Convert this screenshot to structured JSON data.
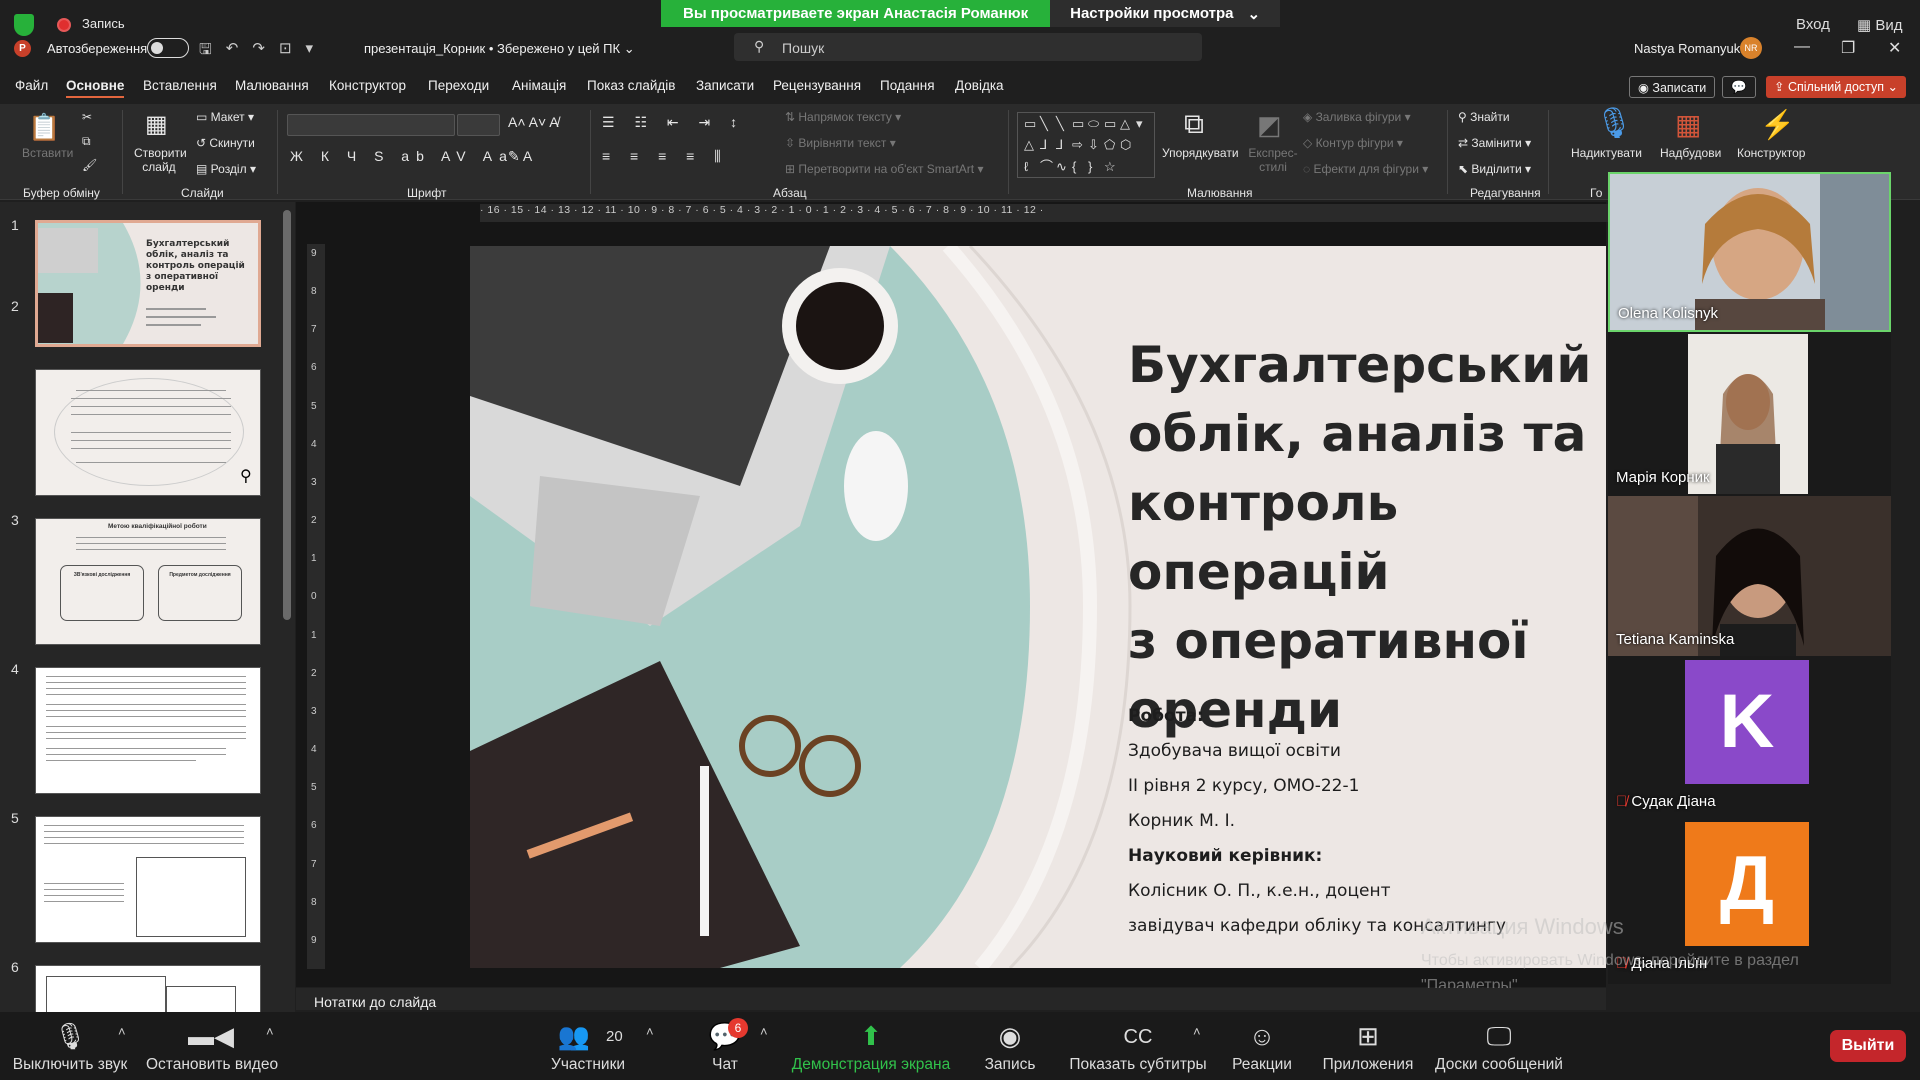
{
  "zoom": {
    "share_banner": {
      "message": "Вы просматриваете экран Анастасія Романюк",
      "settings_label": "Настройки просмотра"
    },
    "recording_label": "Запись",
    "top_right": {
      "signin": "Вход",
      "view": "Вид"
    },
    "toolbar": {
      "mute": "Выключить звук",
      "stop_video": "Остановить видео",
      "participants": "Участники",
      "participants_count": "20",
      "chat": "Чат",
      "chat_badge": "6",
      "share": "Демонстрация экрана",
      "record": "Запись",
      "captions": "Показать субтитры",
      "reactions": "Реакции",
      "apps": "Приложения",
      "whiteboards": "Доски сообщений",
      "leave": "Выйти"
    },
    "participants": [
      {
        "name": "Olena Kolisnyk",
        "speaking": true
      },
      {
        "name": "Марія Корник",
        "speaking": false
      },
      {
        "name": "Tetiana Kaminska",
        "speaking": false
      },
      {
        "name": "Судак Діана",
        "letter": "K",
        "tile_color": "#8a49c9",
        "muted": true
      },
      {
        "name": "Діана Ільїн",
        "letter": "Д",
        "tile_color": "#ef7a1a",
        "muted": true
      }
    ],
    "windows_activation": {
      "title": "Активация Windows",
      "line1": "Чтобы активировать Windows, перейдите в раздел",
      "line2": "\"Параметры\"."
    }
  },
  "powerpoint": {
    "autosave_label": "Автозбереження",
    "file_name": "презентація_Корник • Збережено у цей ПК",
    "search_placeholder": "Пошук",
    "user_name": "Nastya Romanyuk",
    "user_initials": "NR",
    "menu": [
      "Файл",
      "Основне",
      "Вставлення",
      "Малювання",
      "Конструктор",
      "Переходи",
      "Анімація",
      "Показ слайдів",
      "Записати",
      "Рецензування",
      "Подання",
      "Довідка"
    ],
    "active_menu": "Основне",
    "record_button": "Записати",
    "share_button": "Спільний доступ",
    "ribbon": {
      "paste": "Вставити",
      "new_slide": "Створити слайд",
      "layout": "Макет",
      "reset": "Скинути",
      "section": "Розділ",
      "text_direction": "Напрямок тексту",
      "align_text": "Вирівняти текст",
      "smartart": "Перетворити на об'єкт SmartArt",
      "shape_fill": "Заливка фігури",
      "shape_outline": "Контур фігури",
      "shape_effects": "Ефекти для фігури",
      "arrange": "Упорядкувати",
      "quick_styles": "Експрес-стилі",
      "find": "Знайти",
      "replace": "Замінити",
      "select": "Виділити",
      "dictate": "Надиктувати",
      "addins": "Надбудови",
      "designer": "Конструктор",
      "groups": {
        "clipboard": "Буфер обміну",
        "slides": "Слайди",
        "font": "Шрифт",
        "paragraph": "Абзац",
        "drawing": "Малювання",
        "editing": "Редагування",
        "voice": "Го"
      }
    },
    "ruler_h": "· 16 · 15 · 14 · 13 · 12 · 11 · 10 · 9 · 8 · 7 · 6 · 5 · 4 · 3 · 2 · 1 · 0 · 1 · 2 · 3 · 4 · 5 · 6 · 7 · 8 · 9 · 10 · 11 · 12 ·",
    "ruler_v": [
      "9",
      "8",
      "7",
      "6",
      "5",
      "4",
      "3",
      "2",
      "1",
      "0",
      "1",
      "2",
      "3",
      "4",
      "5",
      "6",
      "7",
      "8",
      "9"
    ],
    "thumbnail_numbers": [
      "1",
      "2",
      "3",
      "4",
      "5",
      "6"
    ],
    "thumbnails": {
      "t1_title": "Бухгалтерський облік, аналіз та контроль операцій з оперативної оренди",
      "t3_title": "Метою кваліфікаційної роботи",
      "t3_left": "ЗВ'язкові дослідження",
      "t3_right": "Предметом дослідження"
    },
    "slide": {
      "title": "Бухгалтерський\nоблік, аналіз та\nконтроль операцій\nз оперативної\nоренди",
      "work_label": "Робота:",
      "line1": "Здобувача вищої освіти",
      "line2": "ІІ рівня 2 курсу, ОМО-22-1",
      "line3": "Корник М. І.",
      "advisor_label": "Науковий керівник:",
      "line4": "Колісник О. П., к.е.н., доцент",
      "line5": "завідувач кафедри обліку та консалтингу"
    },
    "notes_label": "Нотатки до слайда"
  }
}
